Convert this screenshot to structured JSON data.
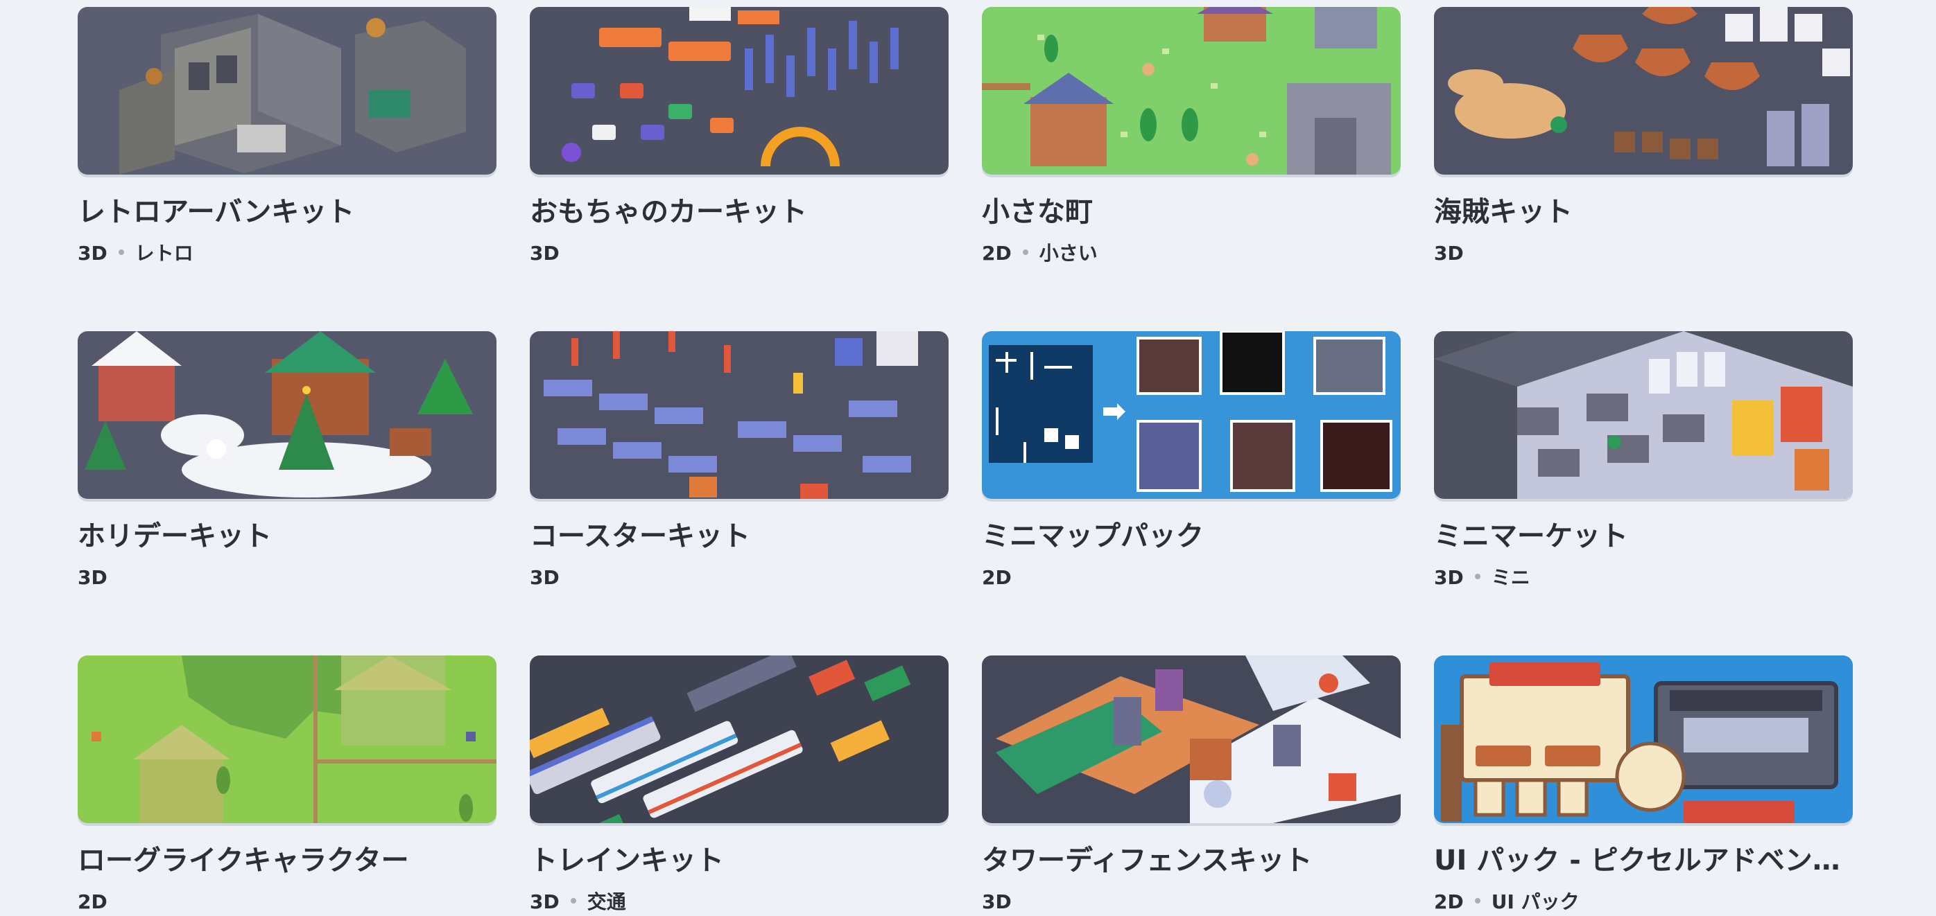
{
  "cards": [
    {
      "title": "レトロアーバンキット",
      "dim": "3D",
      "tag": "レトロ",
      "bg": "#5a5d6e"
    },
    {
      "title": "おもちゃのカーキット",
      "dim": "3D",
      "tag": "",
      "bg": "#4d5060"
    },
    {
      "title": "小さな町",
      "dim": "2D",
      "tag": "小さい",
      "bg": "#7fcf6a"
    },
    {
      "title": "海賊キット",
      "dim": "3D",
      "tag": "",
      "bg": "#4f5264"
    },
    {
      "title": "ホリデーキット",
      "dim": "3D",
      "tag": "",
      "bg": "#55586a"
    },
    {
      "title": "コースターキット",
      "dim": "3D",
      "tag": "",
      "bg": "#505366"
    },
    {
      "title": "ミニマップパック",
      "dim": "2D",
      "tag": "",
      "bg": "#3793d8"
    },
    {
      "title": "ミニマーケット",
      "dim": "3D",
      "tag": "ミニ",
      "bg": "#4e5160"
    },
    {
      "title": "ローグライクキャラクター",
      "dim": "2D",
      "tag": "",
      "bg": "#8ccb4e"
    },
    {
      "title": "トレインキット",
      "dim": "3D",
      "tag": "交通",
      "bg": "#3f4250"
    },
    {
      "title": "タワーディフェンスキット",
      "dim": "3D",
      "tag": "",
      "bg": "#454858"
    },
    {
      "title": "UI パック - ピクセルアドベンチ...",
      "dim": "2D",
      "tag": "UI パック",
      "bg": "#2f8fd8"
    }
  ]
}
